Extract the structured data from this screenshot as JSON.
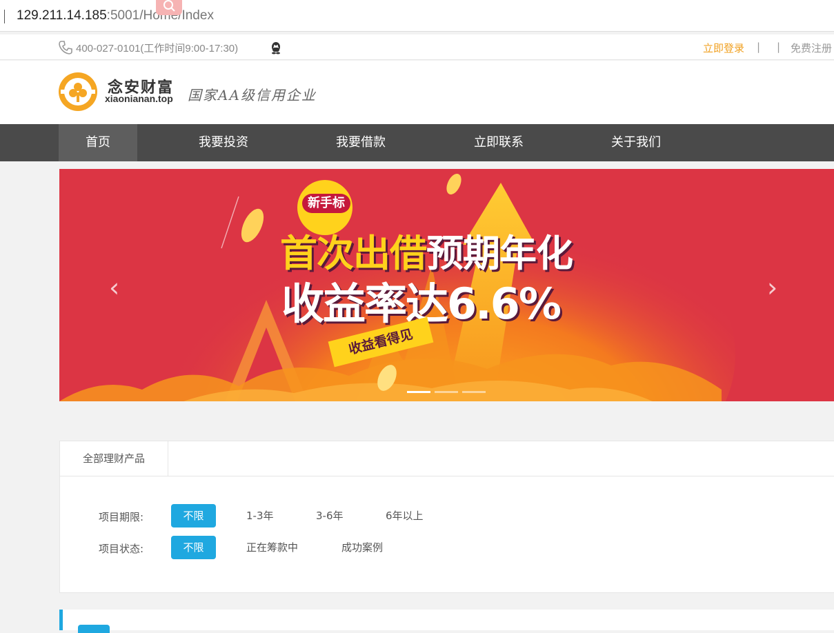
{
  "browser": {
    "url_host": "129.211.14.185",
    "url_path": ":5001/Home/Index"
  },
  "topbar": {
    "phone": "400-027-0101(工作时间9:00-17:30)",
    "login": "立即登录",
    "separator": "|",
    "register": "免费注册"
  },
  "header": {
    "brand_cn": "念安财富",
    "brand_en": "xiaonianan.top",
    "slogan": "国家AA级信用企业"
  },
  "nav": {
    "items": [
      {
        "label": "首页",
        "active": true
      },
      {
        "label": "我要投资"
      },
      {
        "label": "我要借款"
      },
      {
        "label": "立即联系"
      },
      {
        "label": "关于我们"
      }
    ]
  },
  "banner": {
    "badge": "新手标",
    "headline1_hl": "首次出借",
    "headline1_rest": "预期年化",
    "headline2": "收益率达6.6%",
    "ribbon": "收益看得见",
    "prev_arrow": "‹",
    "next_arrow": "›",
    "slide_count": 3,
    "active_slide": 1
  },
  "filter": {
    "tab": "全部理财产品",
    "term_label": "项目期限:",
    "term_options": [
      "不限",
      "1-3年",
      "3-6年",
      "6年以上"
    ],
    "status_label": "项目状态:",
    "status_options": [
      "不限",
      "正在筹款中",
      "成功案例"
    ],
    "selected_color": "#1fa8e0"
  },
  "colors": {
    "nav_bg": "#4a4a4a",
    "login_orange": "#f0a020",
    "banner_red": "#dc3544"
  }
}
